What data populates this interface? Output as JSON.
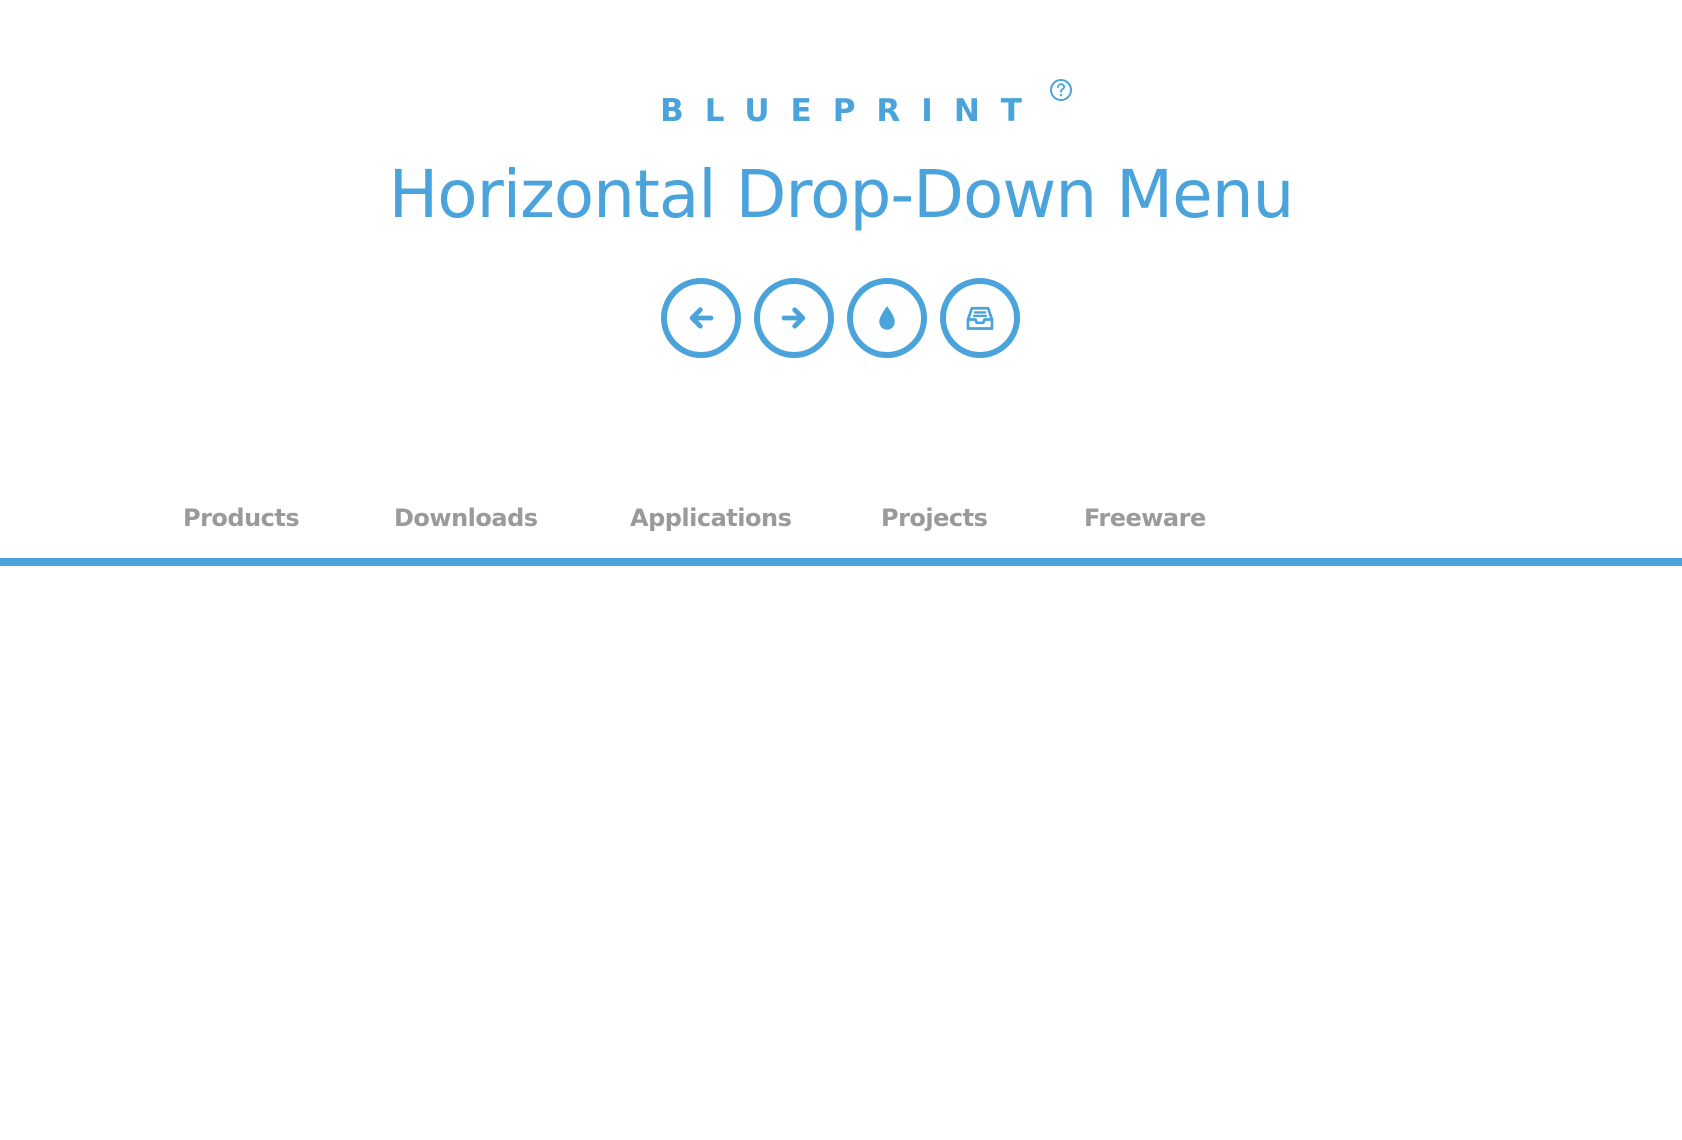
{
  "header": {
    "brand": "BLUEPRINT",
    "brand_badge_icon": "question-circle-icon",
    "title": "Horizontal Drop-Down Menu"
  },
  "toolbar": {
    "buttons": [
      {
        "icon": "arrow-left-icon"
      },
      {
        "icon": "arrow-right-icon"
      },
      {
        "icon": "droplet-icon"
      },
      {
        "icon": "inbox-tray-icon"
      }
    ]
  },
  "nav": {
    "items": [
      {
        "label": "Products"
      },
      {
        "label": "Downloads"
      },
      {
        "label": "Applications"
      },
      {
        "label": "Projects"
      },
      {
        "label": "Freeware"
      }
    ]
  },
  "colors": {
    "accent": "#4aa3da",
    "nav_text": "#9a9a9a",
    "background": "#ffffff"
  }
}
